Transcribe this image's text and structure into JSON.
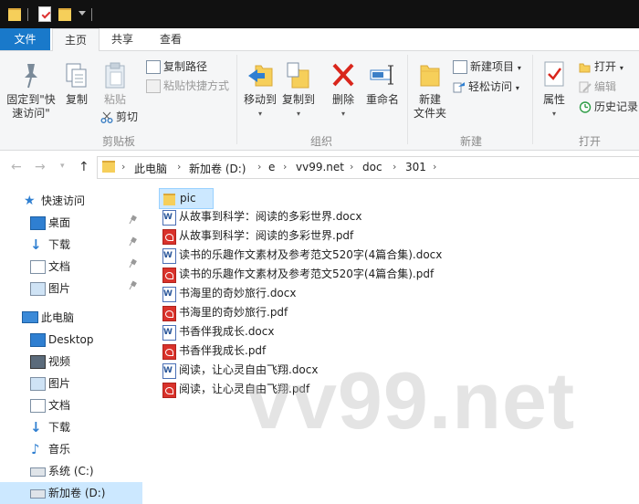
{
  "quick_access_toolbar": {
    "icons": [
      "folder-icon",
      "properties-check-icon",
      "new-folder-icon",
      "customize-dropdown-icon"
    ]
  },
  "tabs": [
    {
      "label": "文件"
    },
    {
      "label": "主页"
    },
    {
      "label": "共享"
    },
    {
      "label": "查看"
    }
  ],
  "ribbon": {
    "clipboard": {
      "pin_label_line1": "固定到\"快",
      "pin_label_line2": "速访问\"",
      "copy": "复制",
      "paste": "粘贴",
      "copy_path": "复制路径",
      "paste_shortcut": "粘贴快捷方式",
      "cut": "剪切",
      "group_label": "剪贴板"
    },
    "organize": {
      "move_to": "移动到",
      "copy_to": "复制到",
      "delete": "删除",
      "rename": "重命名",
      "group_label": "组织"
    },
    "new": {
      "new_folder_line1": "新建",
      "new_folder_line2": "文件夹",
      "new_item": "新建项目",
      "easy_access": "轻松访问",
      "group_label": "新建"
    },
    "open": {
      "properties": "属性",
      "open": "打开",
      "edit": "编辑",
      "history": "历史记录",
      "group_label": "打开"
    }
  },
  "address_bar": {
    "crumbs": [
      "此电脑",
      "新加卷 (D:)",
      "e",
      "vv99.net",
      "doc",
      "301"
    ]
  },
  "nav_pane": {
    "quick_access": "快速访问",
    "pinned": [
      {
        "label": "桌面",
        "icon": "desktop-icon"
      },
      {
        "label": "下载",
        "icon": "download-icon"
      },
      {
        "label": "文档",
        "icon": "documents-icon"
      },
      {
        "label": "图片",
        "icon": "pictures-icon"
      }
    ],
    "this_pc": "此电脑",
    "pc_items": [
      {
        "label": "Desktop",
        "icon": "desktop-icon"
      },
      {
        "label": "视频",
        "icon": "video-icon"
      },
      {
        "label": "图片",
        "icon": "pictures-icon"
      },
      {
        "label": "文档",
        "icon": "documents-icon"
      },
      {
        "label": "下载",
        "icon": "download-icon"
      },
      {
        "label": "音乐",
        "icon": "music-icon"
      },
      {
        "label": "系统 (C:)",
        "icon": "drive-icon"
      },
      {
        "label": "新加卷 (D:)",
        "icon": "drive-icon"
      }
    ]
  },
  "files": [
    {
      "name": "pic",
      "type": "folder"
    },
    {
      "name": "从故事到科学：阅读的多彩世界.docx",
      "type": "docx"
    },
    {
      "name": "从故事到科学：阅读的多彩世界.pdf",
      "type": "pdf"
    },
    {
      "name": "读书的乐趣作文素材及参考范文520字(4篇合集).docx",
      "type": "docx"
    },
    {
      "name": "读书的乐趣作文素材及参考范文520字(4篇合集).pdf",
      "type": "pdf"
    },
    {
      "name": "书海里的奇妙旅行.docx",
      "type": "docx"
    },
    {
      "name": "书海里的奇妙旅行.pdf",
      "type": "pdf"
    },
    {
      "name": "书香伴我成长.docx",
      "type": "docx"
    },
    {
      "name": "书香伴我成长.pdf",
      "type": "pdf"
    },
    {
      "name": "阅读，让心灵自由飞翔.docx",
      "type": "docx"
    },
    {
      "name": "阅读，让心灵自由飞翔.pdf",
      "type": "pdf"
    }
  ],
  "watermark": "vv99.net",
  "colors": {
    "accent": "#1979ca",
    "selection": "#cce8ff",
    "folder": "#f6cf5a",
    "pdf": "#d9322b",
    "word": "#2b579a"
  }
}
